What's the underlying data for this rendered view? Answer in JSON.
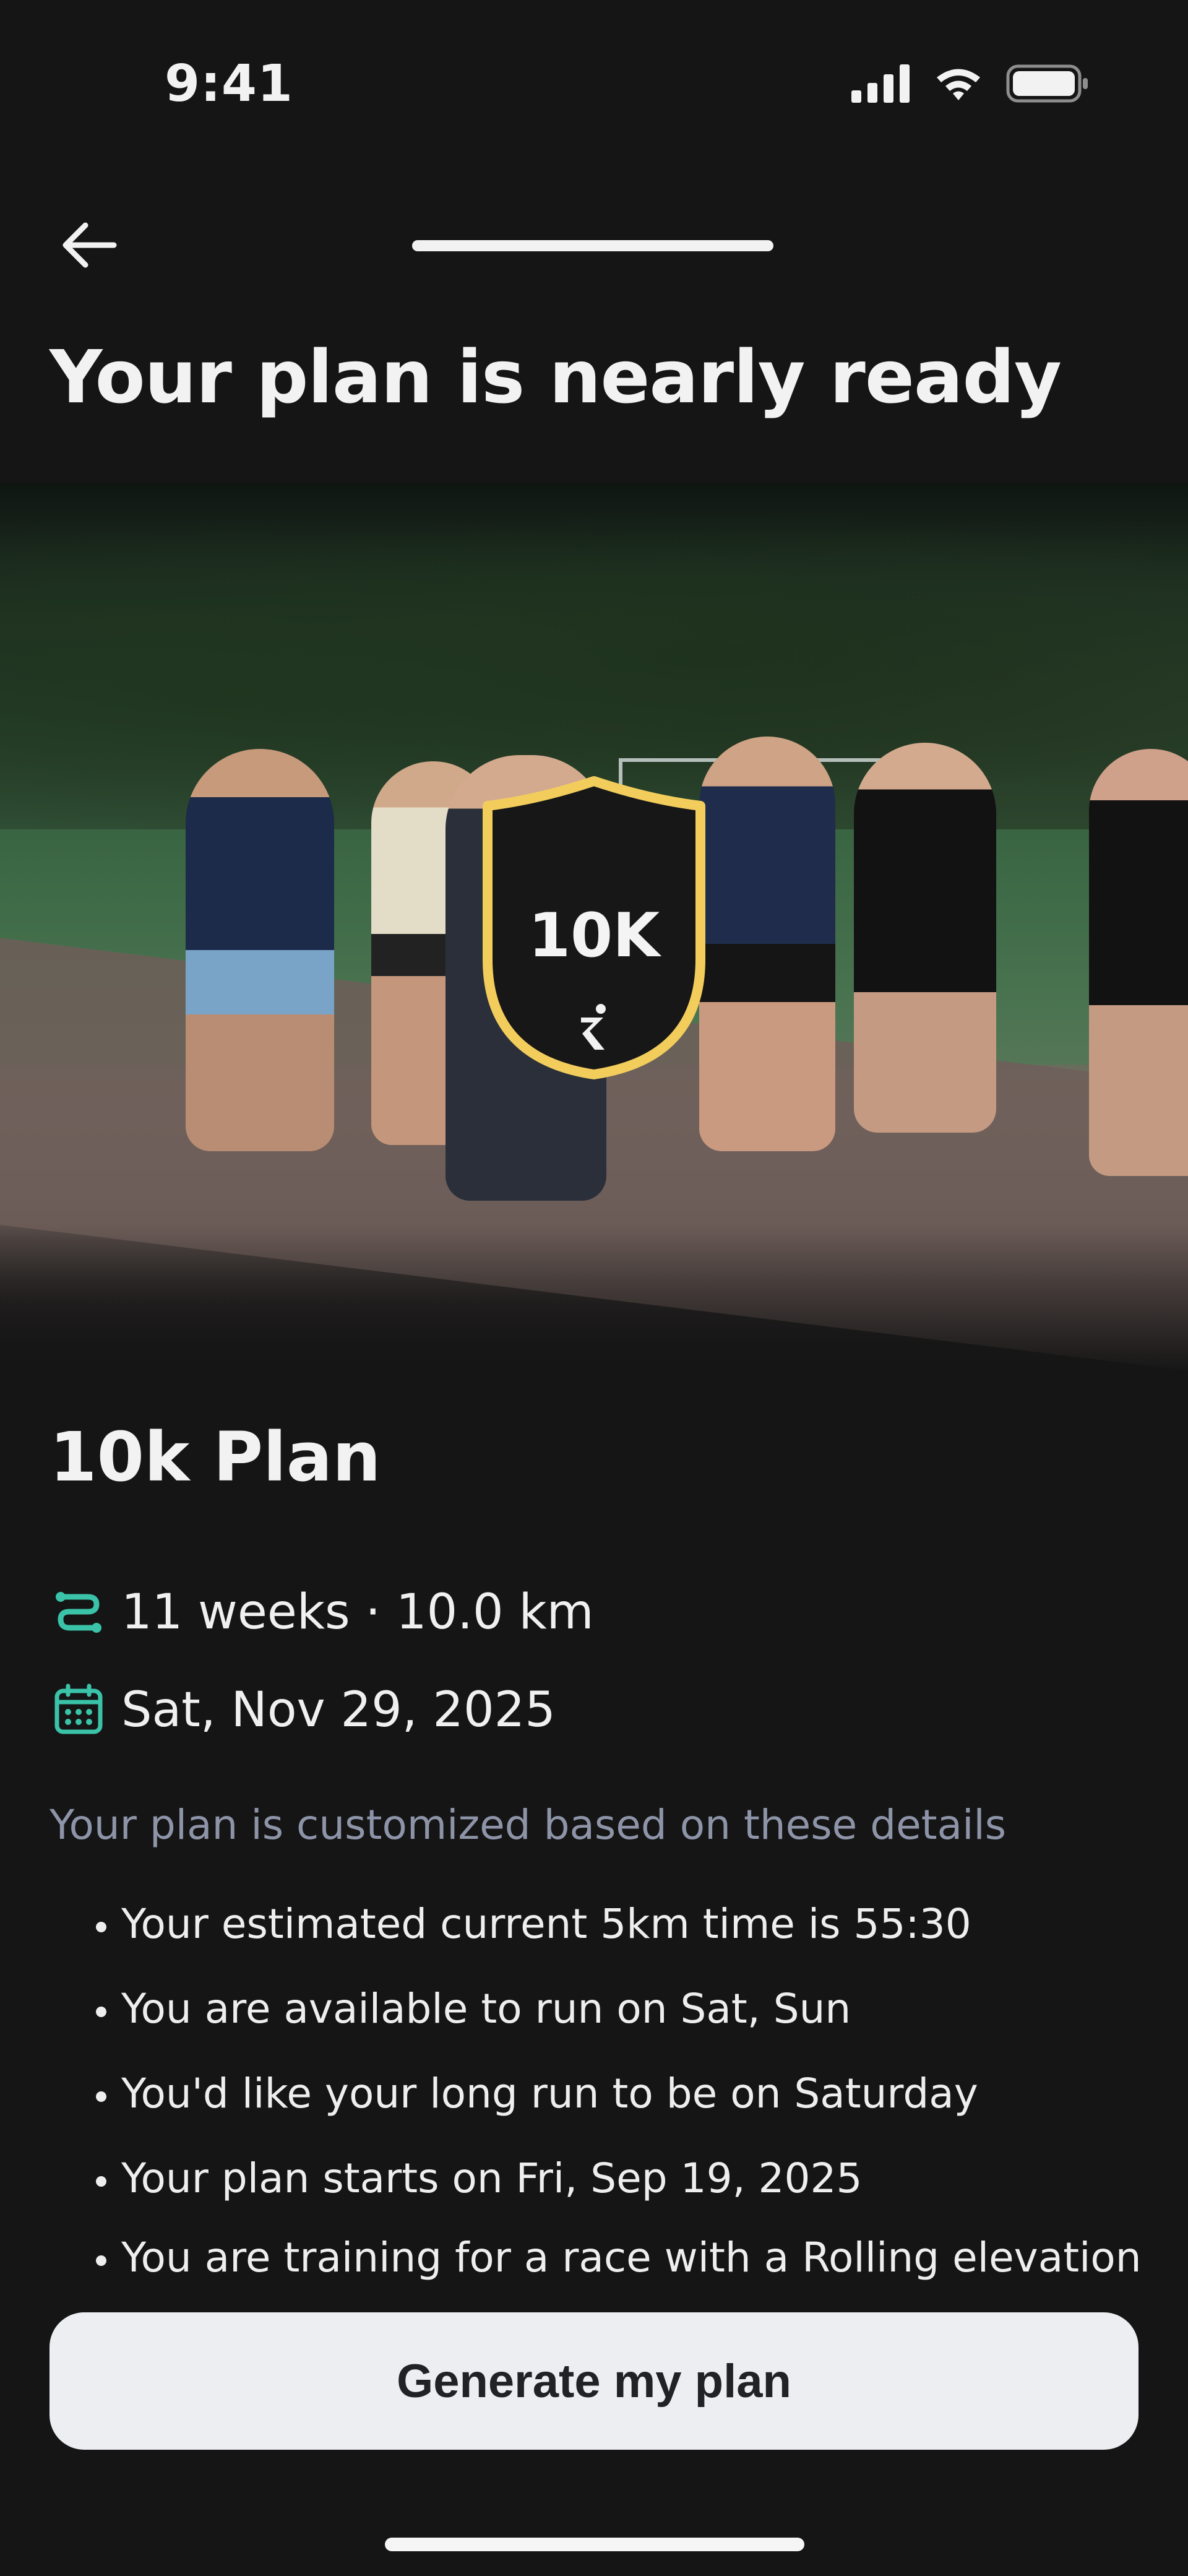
{
  "status_bar": {
    "time": "9:41"
  },
  "header": {
    "back_icon": "arrow-left-icon",
    "title": "Your plan is nearly ready",
    "progress": 1.0
  },
  "hero": {
    "badge_label": "10K",
    "badge_color": "#f2cd5c"
  },
  "plan": {
    "title": "10k Plan",
    "duration_distance": "11 weeks · 10.0 km",
    "race_date": "Sat, Nov 29, 2025",
    "route_icon": "route-icon",
    "calendar_icon": "calendar-icon",
    "accent_color": "#3ac3a8",
    "details_heading": "Your plan is customized based on these details",
    "details": [
      "Your estimated current 5km time is 55:30",
      "You are available to run on Sat, Sun",
      "You'd like your long run to be on Saturday",
      "Your plan starts on Fri, Sep 19, 2025",
      "You are training for a race with a Rolling elevation profile"
    ]
  },
  "cta": {
    "label": "Generate my plan"
  }
}
